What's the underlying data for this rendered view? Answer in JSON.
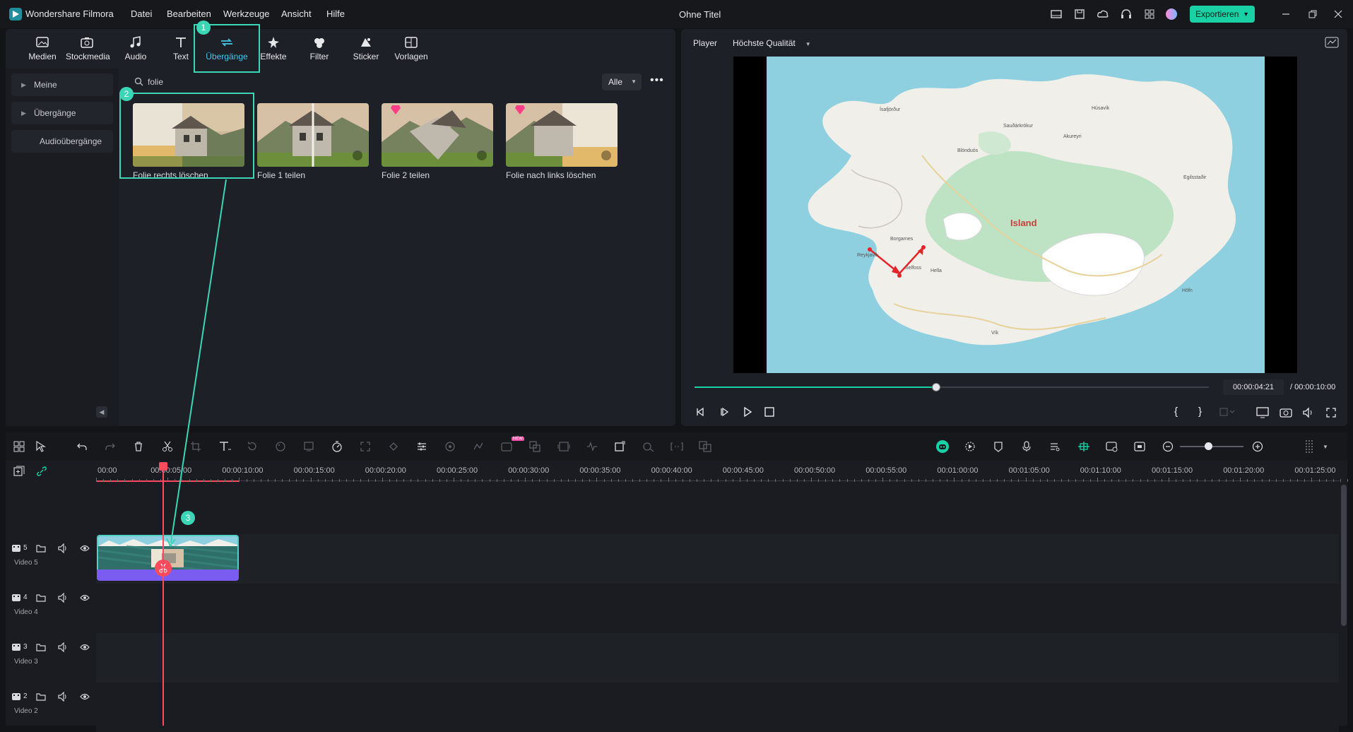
{
  "app": {
    "name": "Wondershare Filmora",
    "doc_title": "Ohne Titel"
  },
  "menu": [
    "Datei",
    "Bearbeiten",
    "Werkzeuge",
    "Ansicht",
    "Hilfe"
  ],
  "export_label": "Exportieren",
  "tabs": [
    {
      "label": "Medien",
      "icon": "media-icon"
    },
    {
      "label": "Stockmedia",
      "icon": "stockmedia-icon"
    },
    {
      "label": "Audio",
      "icon": "music-icon"
    },
    {
      "label": "Text",
      "icon": "text-icon"
    },
    {
      "label": "Übergänge",
      "icon": "transition-icon",
      "active": true
    },
    {
      "label": "Effekte",
      "icon": "effects-icon"
    },
    {
      "label": "Filter",
      "icon": "filter-icon"
    },
    {
      "label": "Sticker",
      "icon": "sticker-icon"
    },
    {
      "label": "Vorlagen",
      "icon": "templates-icon"
    }
  ],
  "sidebar": [
    "Meine",
    "Übergänge",
    "Audioübergänge"
  ],
  "search": {
    "value": "folie"
  },
  "filter": {
    "selected": "Alle"
  },
  "transitions": [
    {
      "label": "Folie rechts löschen"
    },
    {
      "label": "Folie 1 teilen"
    },
    {
      "label": "Folie 2 teilen"
    },
    {
      "label": "Folie nach links löschen"
    }
  ],
  "player": {
    "label": "Player",
    "quality": "Höchste Qualität",
    "current_time": "00:00:04:21",
    "total_time": "/ 00:00:10:00",
    "progress": 0.47,
    "map_label": "Island",
    "map_towns": [
      "Reykjavík",
      "Selfoss",
      "Hella",
      "Vík",
      "Höfn",
      "Akureyri",
      "Húsavík",
      "Egilsstaðir",
      "Ísafjörður",
      "Borgarnes",
      "Blönduós",
      "Sauðárkrókur"
    ]
  },
  "timeline": {
    "ruler": [
      "00:00",
      "00:00:05:00",
      "00:00:10:00",
      "00:00:15:00",
      "00:00:20:00",
      "00:00:25:00",
      "00:00:30:00",
      "00:00:35:00",
      "00:00:40:00",
      "00:00:45:00",
      "00:00:50:00",
      "00:00:55:00",
      "00:01:00:00",
      "00:01:05:00",
      "00:01:10:00",
      "00:01:15:00",
      "00:01:20:00",
      "00:01:25:00"
    ],
    "tracks": [
      {
        "num": "5",
        "name": "Video 5"
      },
      {
        "num": "4",
        "name": "Video 4"
      },
      {
        "num": "3",
        "name": "Video 3"
      },
      {
        "num": "2",
        "name": "Video 2"
      }
    ],
    "new_badge": "NEW"
  },
  "callouts": [
    "1",
    "2",
    "3"
  ],
  "colors": {
    "accent": "#19d1a5",
    "active_tab": "#44c7e6",
    "callout": "#3ad6b6",
    "playhead": "#ff4b5c",
    "audio_clip": "#7a5cf0"
  }
}
